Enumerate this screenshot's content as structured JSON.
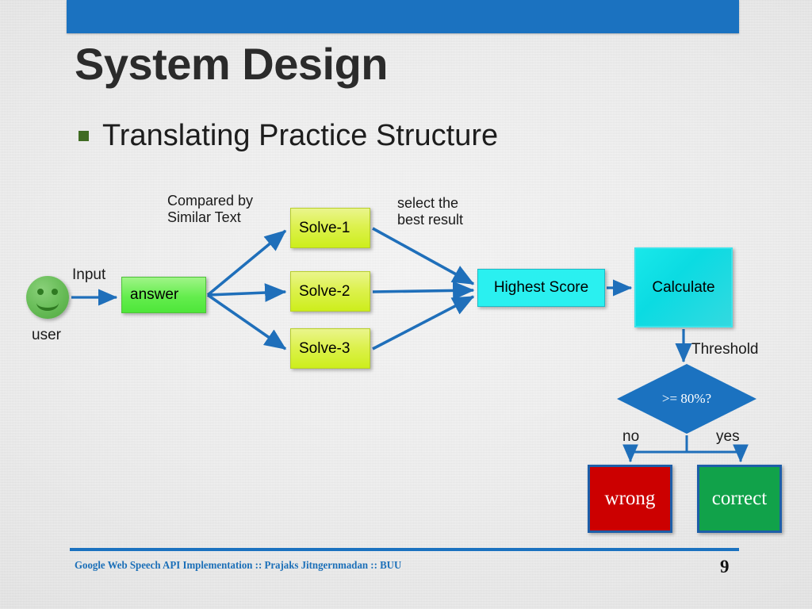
{
  "slide": {
    "title": "System Design",
    "bullet": {
      "marker": "square-bullet",
      "text": "Translating Practice Structure"
    },
    "background_color": "#e8e8e8",
    "accent_color": "#1b72c0"
  },
  "diagram": {
    "nodes": {
      "user": "user",
      "answer": "answer",
      "solve1": "Solve-1",
      "solve2": "Solve-2",
      "solve3": "Solve-3",
      "highest_score": "Highest Score",
      "calculate": "Calculate",
      "decision": ">= 80%?",
      "wrong": "wrong",
      "correct": "correct"
    },
    "edge_labels": {
      "input": "Input",
      "compared_by": "Compared by\nSimilar Text",
      "select_best": "select the\nbest result",
      "threshold": "Threshold",
      "no": "no",
      "yes": "yes"
    },
    "colors": {
      "arrow": "#1f6fba",
      "answer_box": "#64ed4d",
      "solve_box": "#ddf14f",
      "highest_score_box": "#2af0f0",
      "calculate_box": "#0bdbe2",
      "decision_diamond": "#1b72c0",
      "wrong_box": "#cc0000",
      "correct_box": "#11a24a",
      "user_face": "#6cbf5c"
    }
  },
  "footer": {
    "text": "Google Web Speech API Implementation :: Prajaks Jitngernmadan :: BUU",
    "page_number": "9"
  }
}
